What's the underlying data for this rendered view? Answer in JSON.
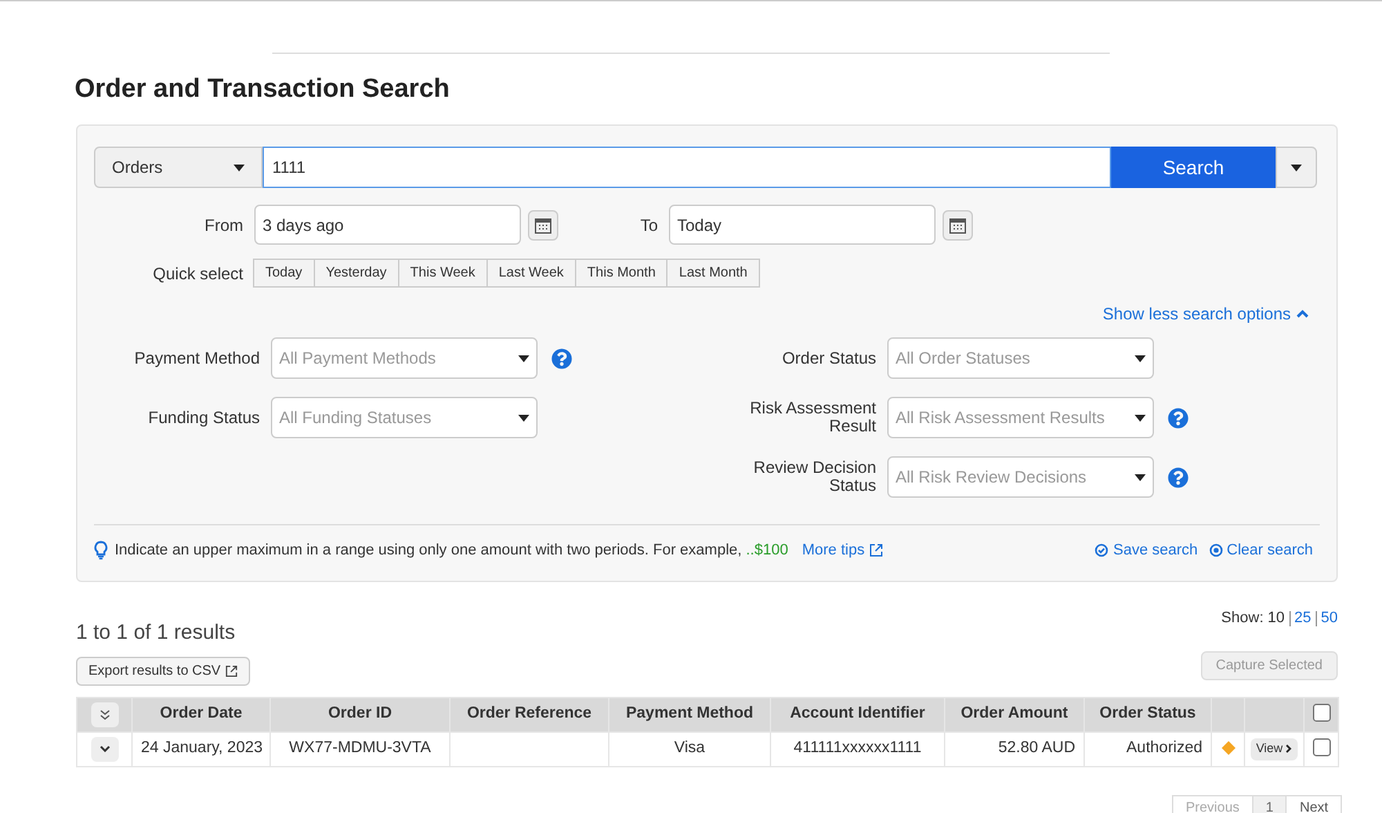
{
  "page_title": "Order and Transaction Search",
  "search": {
    "type_select": "Orders",
    "query": "1111",
    "button": "Search"
  },
  "date_range": {
    "from_label": "From",
    "from_value": "3 days ago",
    "to_label": "To",
    "to_value": "Today"
  },
  "quick_select": {
    "label": "Quick select",
    "options": [
      {
        "label": "Today",
        "selected": false
      },
      {
        "label": "Yesterday",
        "selected": false
      },
      {
        "label": "This Week",
        "selected": false
      },
      {
        "label": "Last Week",
        "selected": false
      },
      {
        "label": "This Month",
        "selected": false
      },
      {
        "label": "Last Month",
        "selected": false
      }
    ]
  },
  "toggle_options": "Show less search options",
  "filters_left": [
    {
      "label": "Payment Method",
      "placeholder": "All Payment Methods",
      "help": true
    },
    {
      "label": "Funding Status",
      "placeholder": "All Funding Statuses",
      "help": false
    }
  ],
  "filters_right": [
    {
      "label": "Order Status",
      "placeholder": "All Order Statuses",
      "help": false
    },
    {
      "label": "Risk Assessment Result",
      "placeholder": "All Risk Assessment Results",
      "help": true
    },
    {
      "label": "Review Decision Status",
      "placeholder": "All Risk Review Decisions",
      "help": true
    }
  ],
  "tip": {
    "text": "Indicate an upper maximum in a range using only one amount with two periods. For example,",
    "example": "..$100",
    "link": "More tips"
  },
  "save_search": "Save search",
  "clear_search": "Clear search",
  "results_count": "1 to 1 of 1 results",
  "page_size": {
    "label": "Show:",
    "options": [
      {
        "label": "10",
        "selected": true
      },
      {
        "label": "25",
        "selected": false
      },
      {
        "label": "50",
        "selected": false
      }
    ]
  },
  "export_button": "Export results to CSV",
  "capture_button": {
    "label": "Capture Selected",
    "disabled": true
  },
  "table": {
    "columns": [
      "Order Date",
      "Order ID",
      "Order Reference",
      "Payment Method",
      "Account Identifier",
      "Order Amount",
      "Order Status"
    ],
    "select_all_checked": false,
    "rows": [
      {
        "cells": [
          "24 January, 2023",
          "WX77-MDMU-3VTA",
          "",
          "Visa",
          "411111xxxxxx1111",
          "52.80 AUD",
          "Authorized"
        ],
        "color": "#f5a623",
        "view": "View",
        "checked": false
      }
    ]
  },
  "pagination": [
    {
      "label": "Previous",
      "disabled": true,
      "selected": false
    },
    {
      "label": "1",
      "disabled": false,
      "selected": true
    },
    {
      "label": "Next",
      "disabled": false,
      "selected": false
    }
  ]
}
